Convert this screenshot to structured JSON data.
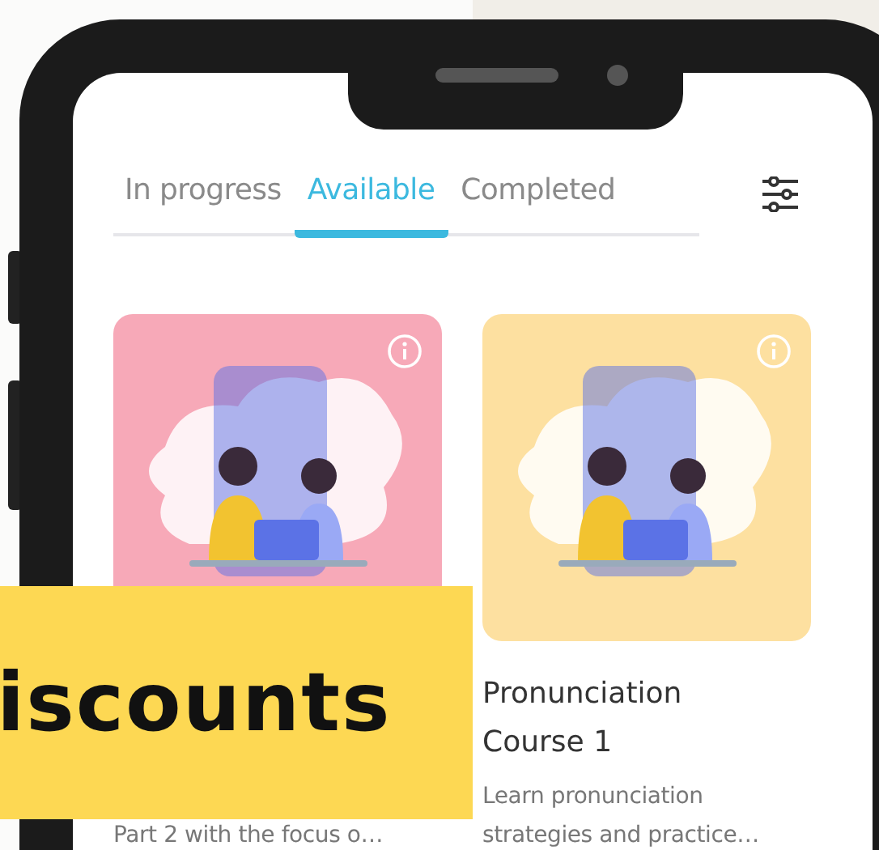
{
  "tabs": [
    {
      "label": "In progress",
      "selected": false
    },
    {
      "label": "Available",
      "selected": true
    },
    {
      "label": "Completed",
      "selected": false
    }
  ],
  "courses": [
    {
      "color": "#f7a9b8",
      "description_lines": [
        "Part 2 with the focus o…"
      ]
    },
    {
      "color": "#fde0a0",
      "title_lines": [
        "Pronunciation",
        "Course 1"
      ],
      "description_lines": [
        "Learn pronunciation",
        "strategies and practice…"
      ]
    }
  ],
  "banner": {
    "text": "iscounts"
  }
}
